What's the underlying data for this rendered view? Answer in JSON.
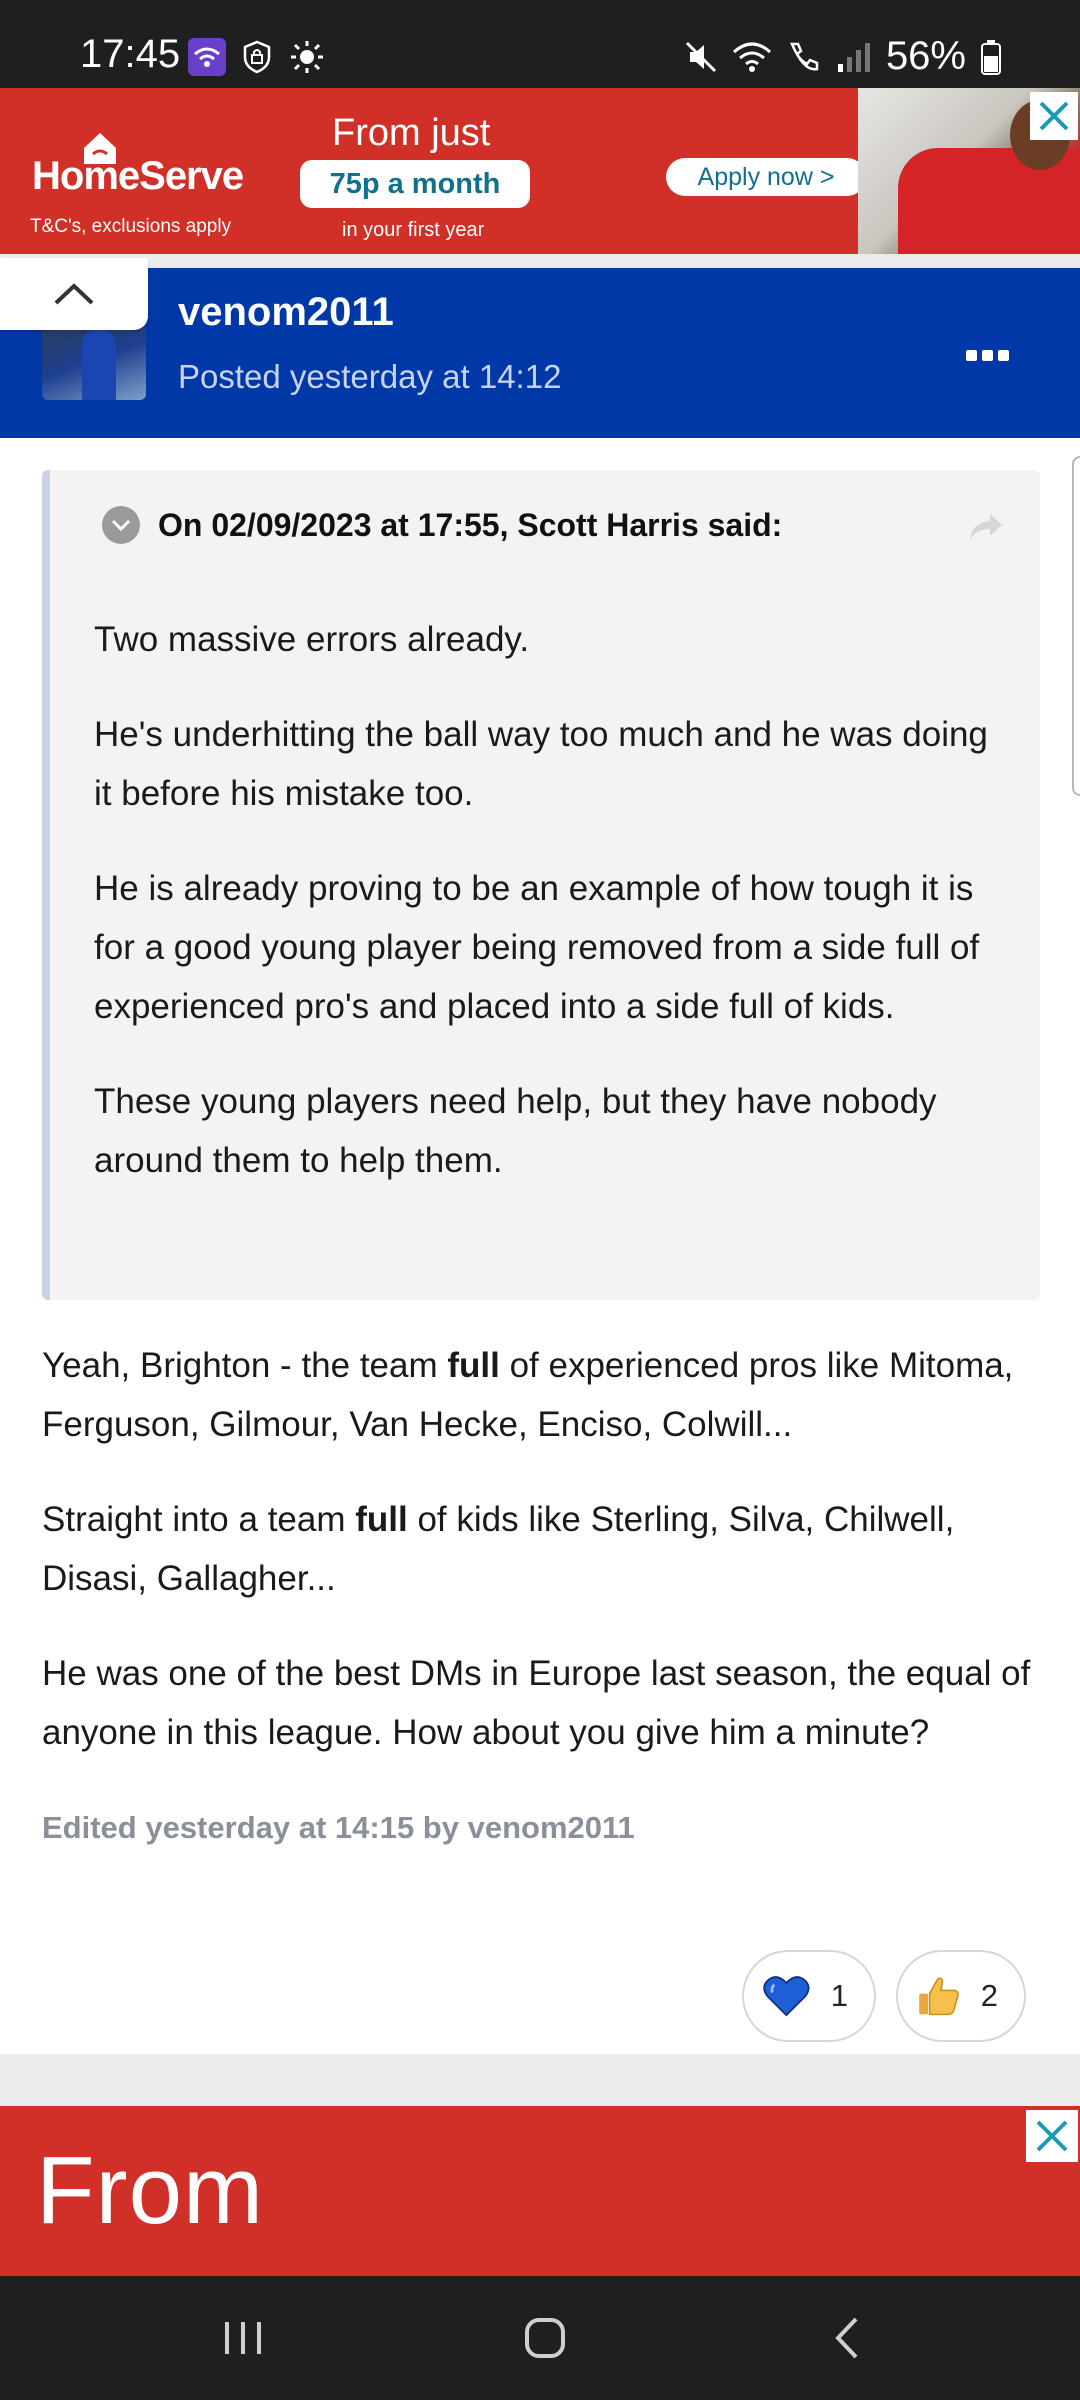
{
  "status_bar": {
    "time": "17:45",
    "battery": "56%"
  },
  "ad_top": {
    "brand": "HomeServe",
    "terms": "T&C's, exclusions apply",
    "headline": "From just",
    "price": "75p a month",
    "subline": "in your first year",
    "cta": "Apply now >"
  },
  "post": {
    "author": "venom2011",
    "posted": "Posted yesterday at 14:12",
    "quote": {
      "citation": "On 02/09/2023 at 17:55, Scott Harris said:",
      "paragraphs": [
        "Two massive errors already.",
        "He's underhitting the ball way too much and he was doing it before his mistake too.",
        "He is already proving to be an example of how tough it is for a good young player being removed from a side full of experienced pro's and placed into a side full of kids.",
        "These young players need help, but they have nobody around them to help them."
      ]
    },
    "body": {
      "p1_a": "Yeah, Brighton - the team ",
      "p1_bold": "full",
      "p1_b": " of experienced pros like Mitoma, Ferguson, Gilmour, Van Hecke, Enciso, Colwill...",
      "p2_a": "Straight into a team ",
      "p2_bold": "full",
      "p2_b": " of kids like Sterling, Silva, Chilwell, Disasi, Gallagher...",
      "p3": "He was one of the best DMs in Europe last season, the equal of anyone in this league. How about you give him a minute?"
    },
    "edited": "Edited yesterday at 14:15 by venom2011",
    "reactions": {
      "love_count": "1",
      "like_count": "2"
    }
  },
  "ad_bottom": {
    "text": "From"
  },
  "colors": {
    "header_blue": "#0038a8",
    "ad_red": "#d03027",
    "quote_bar": "#c9d3e6"
  }
}
